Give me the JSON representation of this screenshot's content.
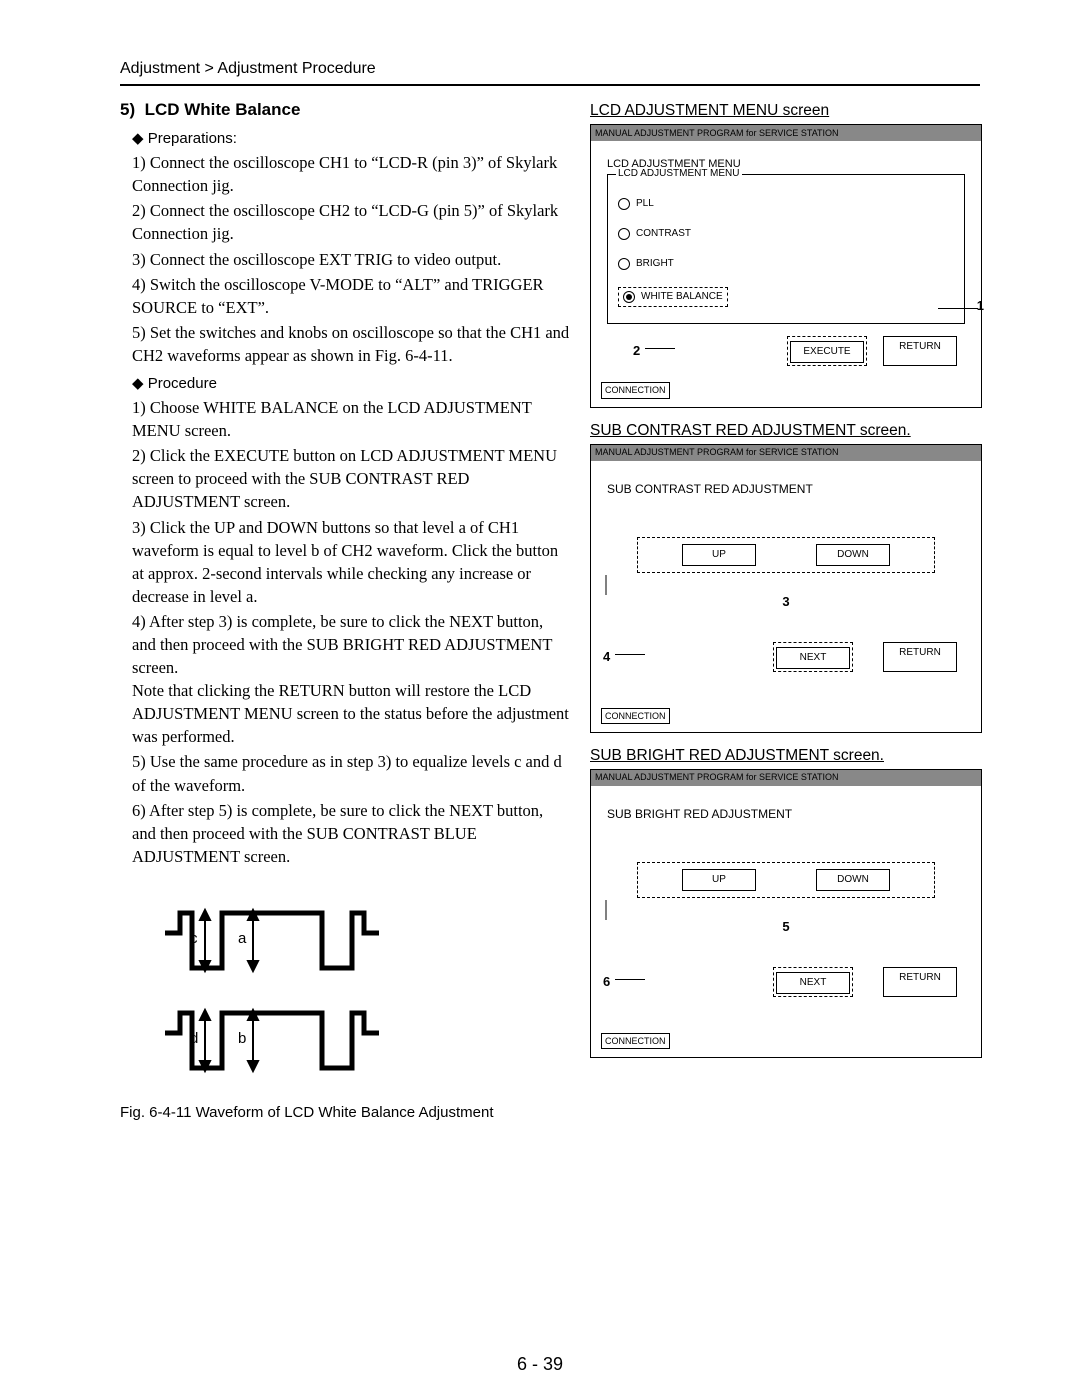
{
  "breadcrumb": "Adjustment > Adjustment Procedure",
  "section": {
    "number": "5)",
    "title": "LCD White Balance"
  },
  "prep_label": "◆ Preparations:",
  "preparations": [
    "1) Connect the oscilloscope CH1 to “LCD-R (pin 3)” of Skylark Connection jig.",
    "2) Connect the oscilloscope CH2 to “LCD-G (pin 5)” of Skylark Connection jig.",
    "3) Connect the oscilloscope EXT TRIG to video output.",
    "4) Switch the oscilloscope V-MODE to “ALT” and TRIGGER SOURCE to “EXT”.",
    "5) Set the switches and knobs on oscilloscope so that the CH1 and CH2 waveforms appear as shown in Fig. 6-4-11."
  ],
  "proc_label": "◆ Procedure",
  "procedure": [
    "1) Choose WHITE BALANCE on the LCD ADJUSTMENT MENU screen.",
    "2) Click the EXECUTE button on LCD ADJUSTMENT MENU screen to proceed with the SUB CONTRAST RED ADJUSTMENT screen.",
    "3) Click the UP and DOWN buttons so that level a of CH1 waveform is equal to level b of CH2 waveform. Click the button at approx. 2-second intervals while checking any increase or decrease in level a.",
    "4) After step 3) is complete, be sure to click the NEXT button, and then proceed with the SUB BRIGHT RED ADJUSTMENT screen.\nNote that clicking the RETURN button will restore the LCD ADJUSTMENT MENU screen to the status before the adjustment was performed.",
    "5) Use the same procedure as in step 3) to equalize levels c and d of the waveform.",
    "6) After step 5) is complete, be sure to click the NEXT button, and then proceed with the SUB CONTRAST BLUE ADJUSTMENT screen."
  ],
  "fig_caption": "Fig. 6-4-11 Waveform of LCD White Balance Adjustment",
  "waveform_labels": {
    "a": "a",
    "b": "b",
    "c": "c",
    "d": "d"
  },
  "page_number": "6 - 39",
  "screen1": {
    "label": "LCD ADJUSTMENT MENU screen",
    "titlebar": "MANUAL ADJUSTMENT PROGRAM for SERVICE STATION",
    "heading": "LCD ADJUSTMENT MENU",
    "legend": "LCD ADJUSTMENT MENU",
    "options": [
      "PLL",
      "CONTRAST",
      "BRIGHT",
      "WHITE BALANCE"
    ],
    "execute": "EXECUTE",
    "return": "RETURN",
    "connection": "CONNECTION",
    "ann1": "1",
    "ann2": "2"
  },
  "screen2": {
    "label": "SUB CONTRAST RED ADJUSTMENT screen.",
    "titlebar": "MANUAL ADJUSTMENT PROGRAM for SERVICE STATION",
    "heading": "SUB CONTRAST RED ADJUSTMENT",
    "up": "UP",
    "down": "DOWN",
    "next": "NEXT",
    "return": "RETURN",
    "connection": "CONNECTION",
    "ann3": "3",
    "ann4": "4"
  },
  "screen3": {
    "label": "SUB BRIGHT RED ADJUSTMENT screen.",
    "titlebar": "MANUAL ADJUSTMENT PROGRAM for SERVICE STATION",
    "heading": "SUB BRIGHT RED ADJUSTMENT",
    "up": "UP",
    "down": "DOWN",
    "next": "NEXT",
    "return": "RETURN",
    "connection": "CONNECTION",
    "ann5": "5",
    "ann6": "6"
  }
}
